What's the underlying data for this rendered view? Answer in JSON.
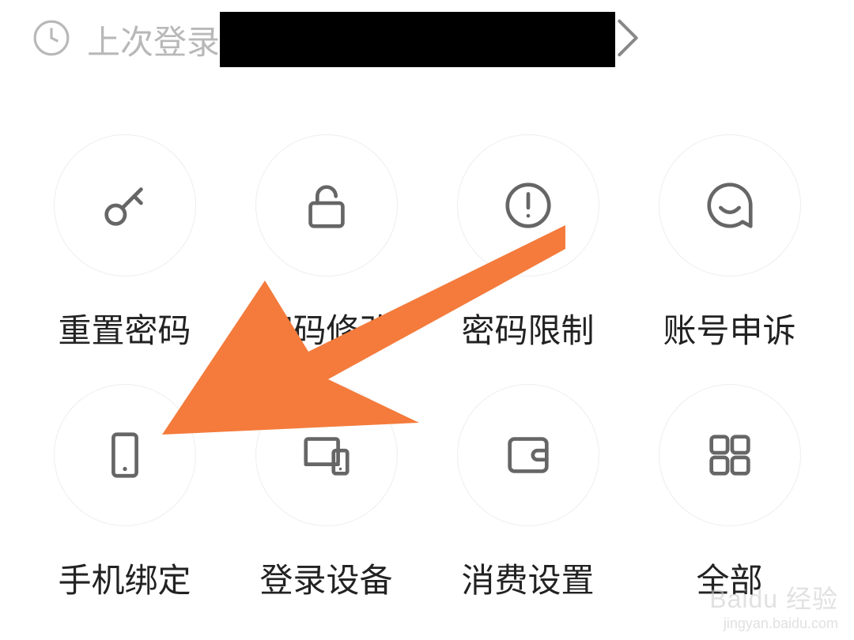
{
  "header": {
    "last_login_label": "上次登录"
  },
  "grid": {
    "items": [
      {
        "label": "重置密码",
        "icon": "key-icon"
      },
      {
        "label": "密码修改",
        "icon": "lock-icon"
      },
      {
        "label": "密码限制",
        "icon": "alert-circle-icon"
      },
      {
        "label": "账号申诉",
        "icon": "chat-smile-icon"
      },
      {
        "label": "手机绑定",
        "icon": "phone-icon"
      },
      {
        "label": "登录设备",
        "icon": "devices-icon"
      },
      {
        "label": "消费设置",
        "icon": "wallet-icon"
      },
      {
        "label": "全部",
        "icon": "grid-icon"
      }
    ]
  },
  "watermark": {
    "main": "Baidu 经验",
    "sub": "jingyan.baidu.com"
  },
  "annotation": {
    "arrow_color": "#f47b3c",
    "arrow_target": "手机绑定"
  }
}
